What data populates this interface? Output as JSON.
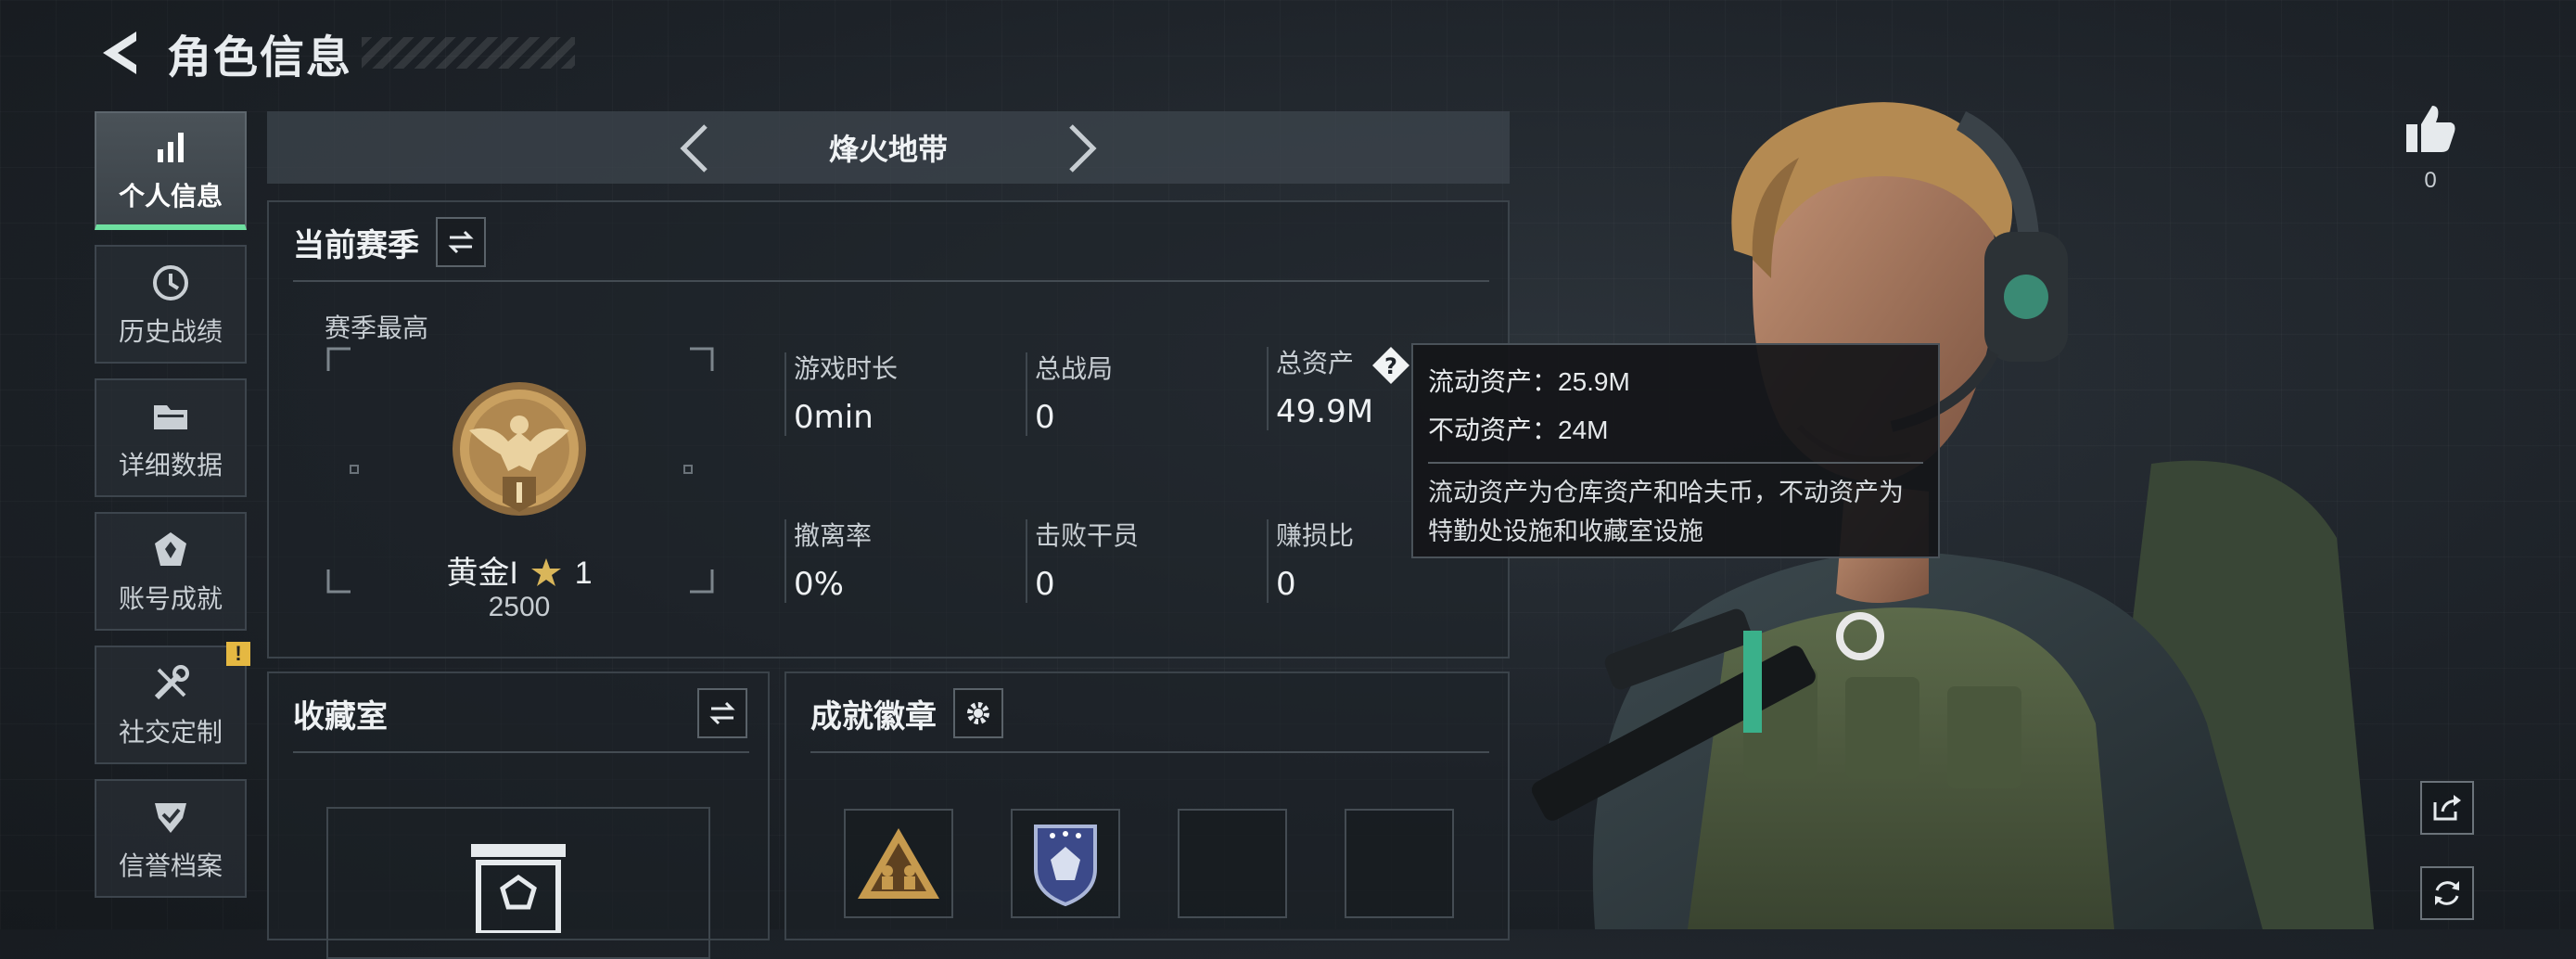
{
  "header": {
    "title": "角色信息",
    "back_icon": "back-arrow-icon"
  },
  "sidebar": {
    "items": [
      {
        "label": "个人信息",
        "icon": "bar-chart-icon",
        "active": true
      },
      {
        "label": "历史战绩",
        "icon": "history-clock-icon"
      },
      {
        "label": "详细数据",
        "icon": "folder-icon"
      },
      {
        "label": "账号成就",
        "icon": "achievement-icon"
      },
      {
        "label": "社交定制",
        "icon": "tools-icon",
        "badge": "!"
      },
      {
        "label": "信誉档案",
        "icon": "shield-check-icon"
      }
    ]
  },
  "mode": {
    "title": "烽火地带"
  },
  "season": {
    "panel_title": "当前赛季",
    "best_label": "赛季最高",
    "rank_name": "黄金I",
    "rank_stars": "1",
    "rank_score": "2500",
    "stats": [
      {
        "label": "游戏时长",
        "value": "0min"
      },
      {
        "label": "总战局",
        "value": "0"
      },
      {
        "label": "总资产",
        "value": "49.9M",
        "help": true
      },
      {
        "label": "撤离率",
        "value": "0%"
      },
      {
        "label": "击败干员",
        "value": "0"
      },
      {
        "label": "赚损比",
        "value": "0"
      }
    ]
  },
  "tooltip": {
    "liquid": "流动资产：25.9M",
    "fixed": "不动资产：24M",
    "description": "流动资产为仓库资产和哈夫币，不动资产为特勤处设施和收藏室设施"
  },
  "collection": {
    "panel_title": "收藏室"
  },
  "badges": {
    "panel_title": "成就徽章"
  },
  "likes": {
    "count": "0"
  },
  "colors": {
    "accent_green": "#6ee0a0",
    "warning_yellow": "#e5b842",
    "rank_gold": "#c9a060"
  }
}
